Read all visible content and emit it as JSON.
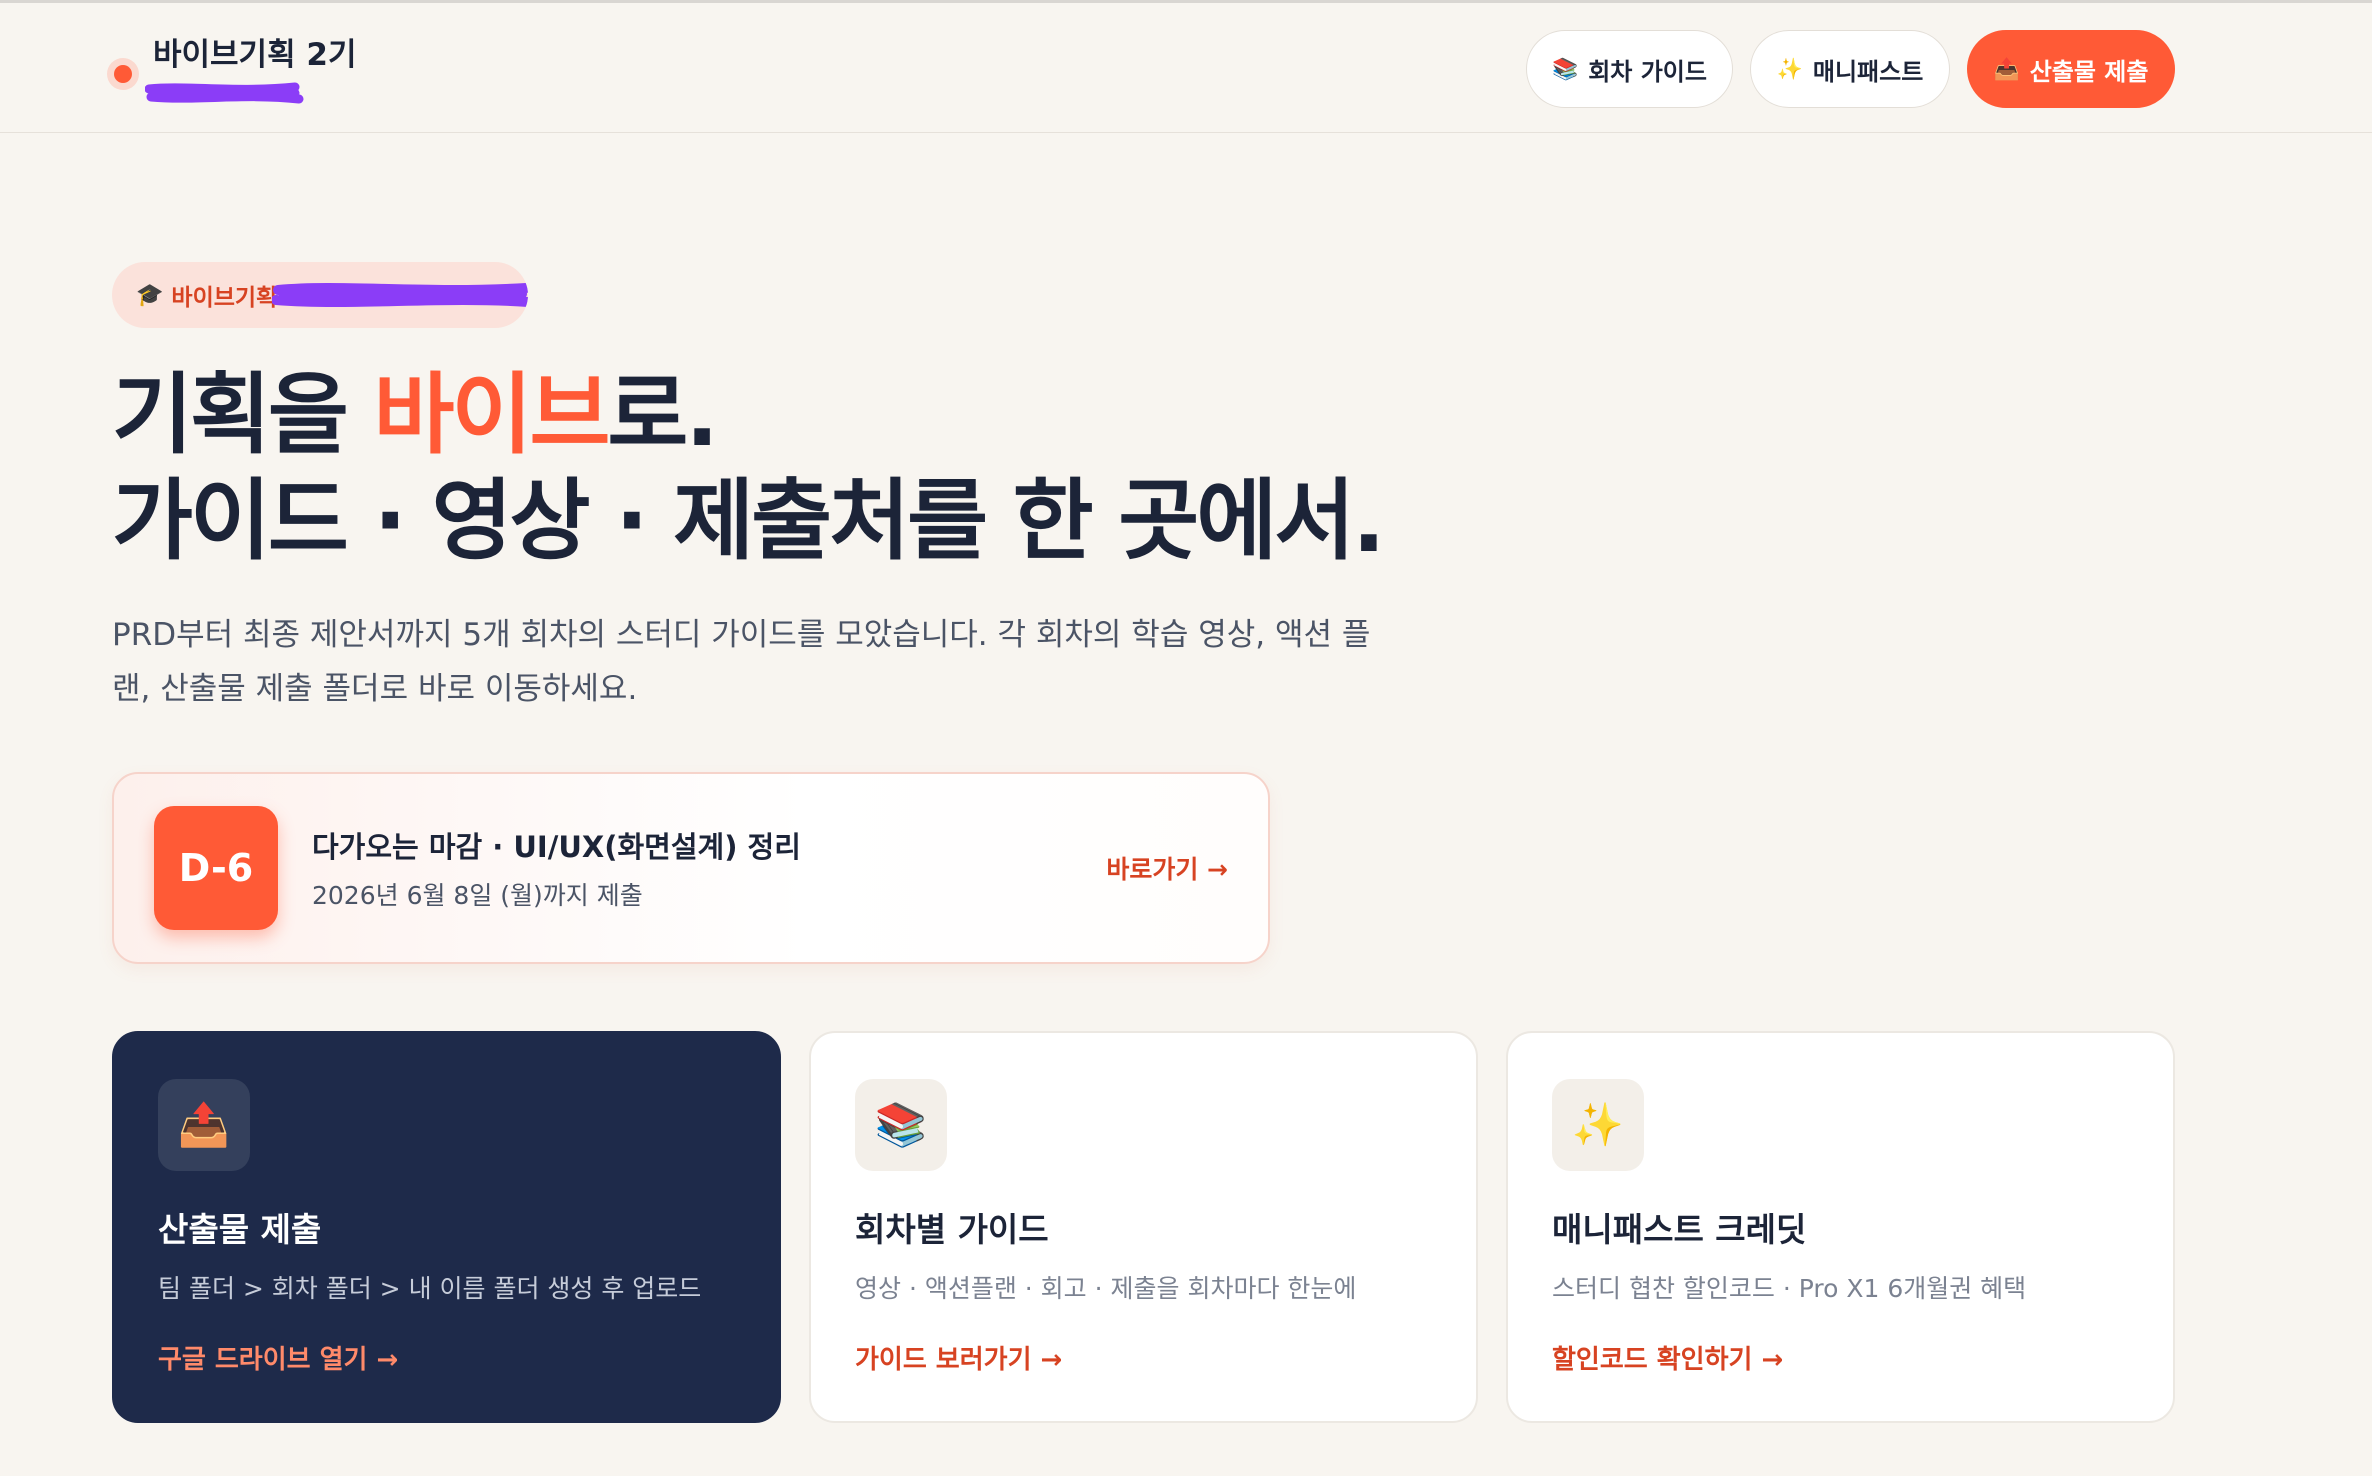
{
  "header": {
    "brand": "바이브기획 2기",
    "nav": [
      {
        "icon": "📚",
        "label": "회차 가이드"
      },
      {
        "icon": "✨",
        "label": "매니패스트"
      },
      {
        "icon": "📤",
        "label": "산출물 제출"
      }
    ]
  },
  "hero": {
    "badge_icon": "🎓",
    "badge_text": "바이브기획",
    "title_line1_pre": "기획을 ",
    "title_line1_accent": "바이브",
    "title_line1_post": "로.",
    "title_line2": "가이드 · 영상 · 제출처를 한 곳에서.",
    "lead": "PRD부터 최종 제안서까지 5개 회차의 스터디 가이드를 모았습니다. 각 회차의 학습 영상, 액션 플랜, 산출물 제출 폴더로 바로 이동하세요."
  },
  "deadline": {
    "dday": "D-6",
    "title": "다가오는 마감 · UI/UX(화면설계) 정리",
    "date": "2026년 6월 8일 (월)까지 제출",
    "link": "바로가기 →"
  },
  "cards": [
    {
      "icon": "📤",
      "title": "산출물 제출",
      "desc": "팀 폴더 > 회차 폴더 > 내 이름 폴더 생성 후 업로드",
      "link": "구글 드라이브 열기 →"
    },
    {
      "icon": "📚",
      "title": "회차별 가이드",
      "desc": "영상 · 액션플랜 · 회고 · 제출을 회차마다 한눈에",
      "link": "가이드 보러가기 →"
    },
    {
      "icon": "✨",
      "title": "매니패스트 크레딧",
      "desc": "스터디 협찬 할인코드 · Pro X1 6개월권 혜택",
      "link": "할인코드 확인하기 →"
    }
  ],
  "colors": {
    "accent": "#ff5a36",
    "dark_card": "#1e2a4a",
    "background": "#f8f5f0",
    "redaction": "#8b3df7"
  }
}
